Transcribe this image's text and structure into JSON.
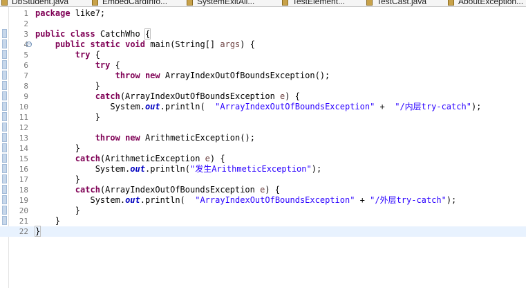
{
  "tabs": [
    {
      "label": "DbStudent.java"
    },
    {
      "label": "EmbedCardInfo..."
    },
    {
      "label": "SystemExitAll..."
    },
    {
      "label": "TestElement..."
    },
    {
      "label": "TestCast.java"
    },
    {
      "label": "AboutException..."
    }
  ],
  "current_line": 22,
  "code": {
    "package_kw": "package",
    "package_name": " like7;",
    "public_kw": "public",
    "class_kw": "class",
    "class_name": " CatchWho ",
    "class_brace": "{",
    "static_kw": "static",
    "void_kw": "void",
    "main_sig": " main(String[] ",
    "args_param": "args",
    "main_tail": ") {",
    "try_kw": "try",
    "open_brace": " {",
    "close_brace": "}",
    "throw_kw": "throw",
    "new_kw": "new",
    "aioobe_ctor": " ArrayIndexOutOfBoundsException();",
    "arith_ctor": " ArithmeticException();",
    "catch_kw": "catch",
    "catch_aioobe": "(ArrayIndexOutOfBoundsException ",
    "catch_arith": "(ArithmeticException ",
    "e_param": "e",
    "catch_tail": ") {",
    "system": "System.",
    "out_field": "out",
    "println": ".println(",
    "println_tail": ");",
    "plus": " + ",
    "str_aioobe": "\"ArrayIndexOutOfBoundsException\"",
    "str_inner": "\"/内层try-catch\"",
    "str_arith": "\"发生ArithmeticException\"",
    "str_outer": "\"/外层try-catch\""
  }
}
